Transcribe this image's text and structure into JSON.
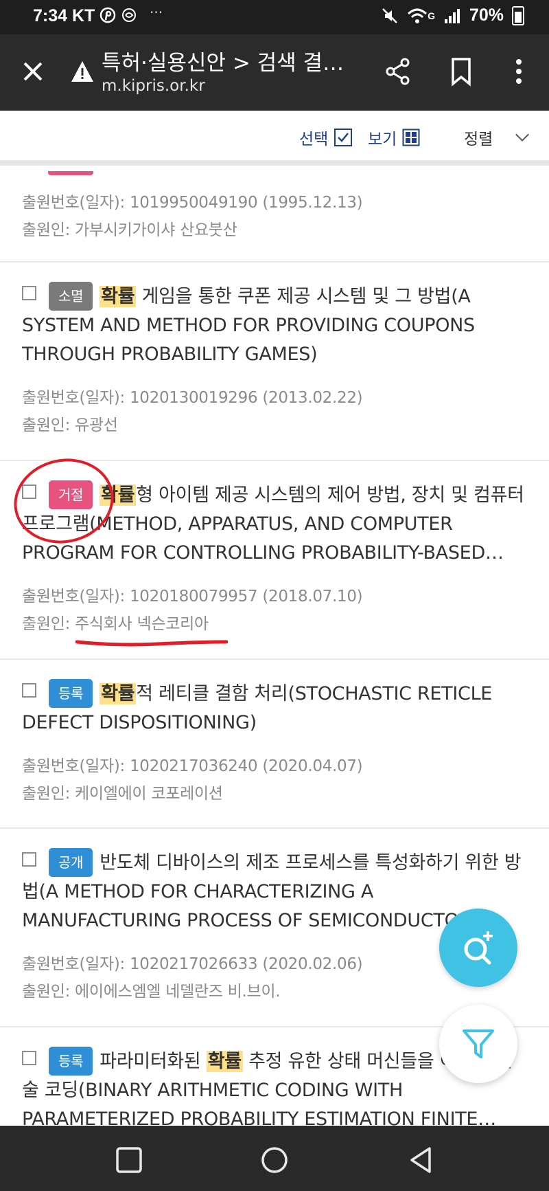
{
  "status_bar": {
    "time": "7:34",
    "carrier": "KT",
    "more": "···",
    "network": "G",
    "battery": "70%"
  },
  "browser": {
    "title": "특허·실용신안 > 검색 결과...",
    "url": "m.kipris.or.kr"
  },
  "controls": {
    "select_label": "선택",
    "view_label": "보기",
    "sort_label": "정렬"
  },
  "results": {
    "meta_number_label": "출원번호(일자): ",
    "meta_applicant_label": "출원인: ",
    "partial_first": {
      "number": "1019950049190 (1995.12.13)",
      "applicant": "가부시키가이샤 산요붓산"
    },
    "items": [
      {
        "status": "소멸",
        "title_hl": "확률",
        "title_rest": " 게임을 통한 쿠폰 제공 시스템 및 그 방법(A SYSTEM AND METHOD FOR PROVIDING COUPONS THROUGH PROBABILITY GAMES)",
        "number": "1020130019296 (2013.02.22)",
        "applicant": "유광선"
      },
      {
        "status": "거절",
        "title_hl": "확률",
        "title_rest": "형 아이템 제공 시스템의 제어 방법, 장치 및 컴퓨터 프로그램(METHOD, APPARATUS, AND COMPUTER PROGRAM FOR CONTROLLING PROBABILITY-BASED ITEM PROVISION…",
        "number": "1020180079957 (2018.07.10)",
        "applicant": "주식회사 넥슨코리아"
      },
      {
        "status": "등록",
        "title_hl": "확률",
        "title_rest": "적 레티클 결함 처리(STOCHASTIC RETICLE DEFECT DISPOSITIONING)",
        "number": "1020217036240 (2020.04.07)",
        "applicant": "케이엘에이 코포레이션"
      },
      {
        "status": "공개",
        "title_plain": "반도체 디바이스의 제조 프로세스를 특성화하기 위한 방법(A METHOD FOR CHARACTERIZING A MANUFACTURING PROCESS OF SEMICONDUCTOR DEVICES)",
        "number": "1020217026633 (2020.02.06)",
        "applicant": "에이에스엠엘 네델란즈 비.브이."
      },
      {
        "status": "등록",
        "title_pre": "파라미터화된 ",
        "title_hl": "확률",
        "title_rest": " 추정 유한 상태 머신들을 이용한 산술 코딩(BINARY ARITHMETIC CODING WITH PARAMETERIZED PROBABILITY ESTIMATION FINITE STATE…"
      }
    ]
  },
  "colors": {
    "status_bar_bg": "#1e1e1e",
    "toolbar_bg": "#2b2b2b",
    "accent_navy": "#1f3f8a",
    "badge_gray": "#7a7a7a",
    "badge_pink": "#e8527f",
    "badge_blue": "#2e8fd6",
    "highlight": "#ffe08a",
    "fab_search": "#3fc2e3",
    "annotation_red": "#e21d2a"
  },
  "icons": [
    "close-icon",
    "warning-icon",
    "share-icon",
    "bookmark-icon",
    "more-vert-icon",
    "checkbox-icon",
    "grid-icon",
    "chevron-down-icon",
    "search-plus-icon",
    "filter-icon",
    "nav-recent-icon",
    "nav-home-icon",
    "nav-back-icon"
  ]
}
